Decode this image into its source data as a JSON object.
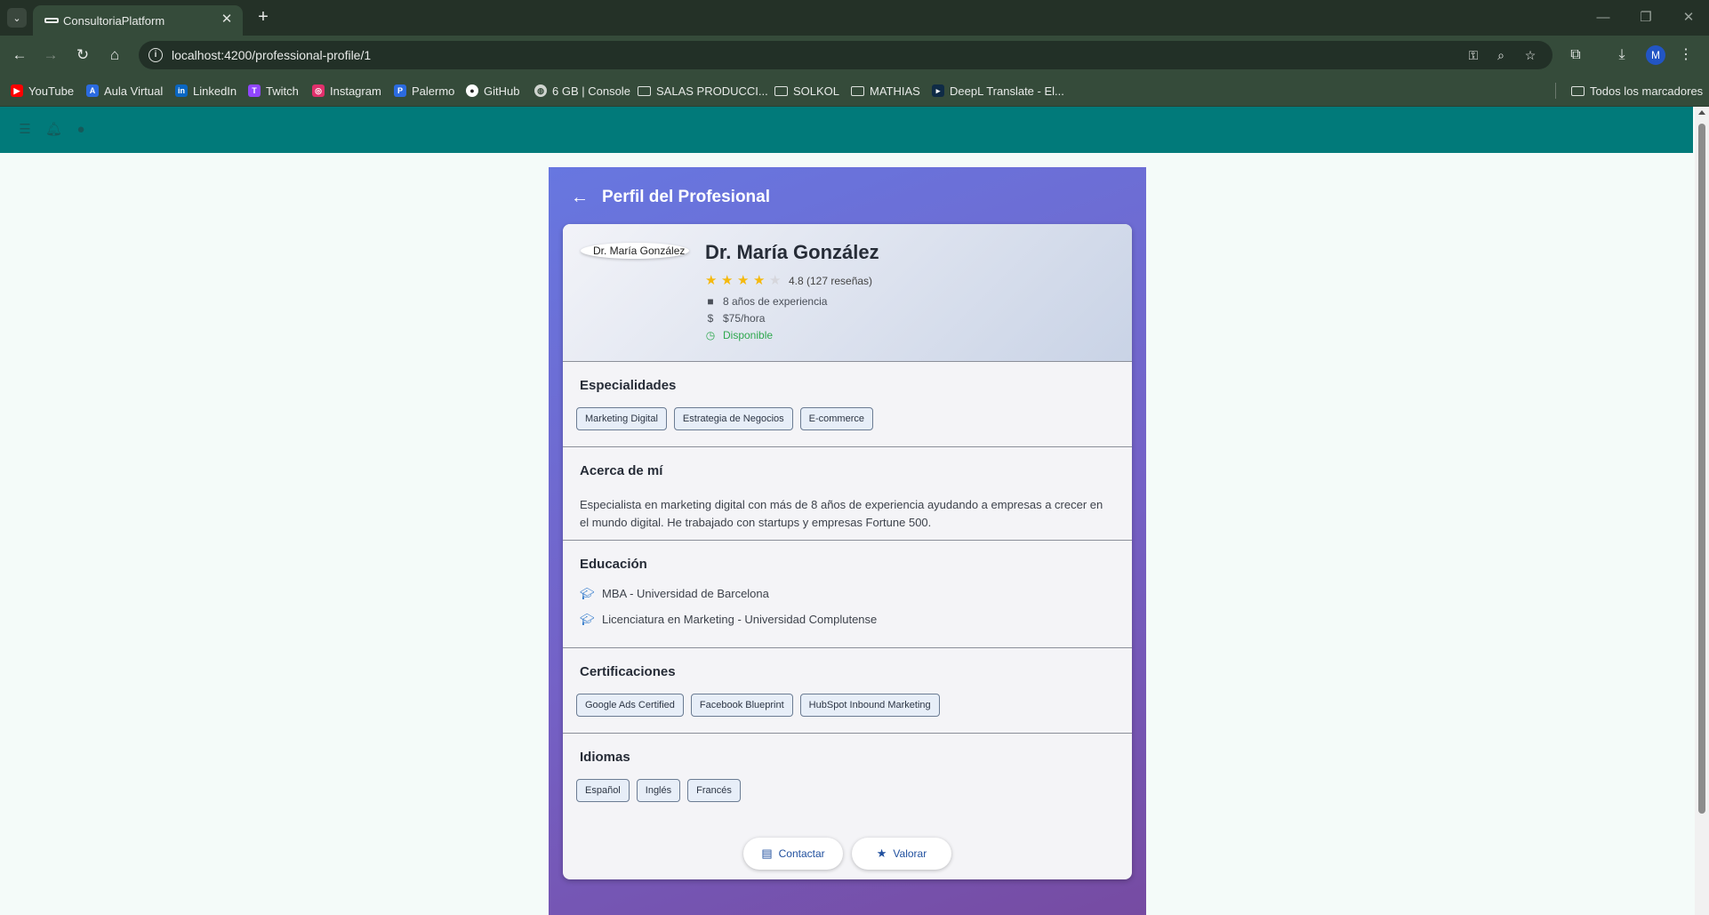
{
  "browser": {
    "tab_title": "ConsultoriaPlatform",
    "url": "localhost:4200/professional-profile/1",
    "profile_initial": "M",
    "bookmarks": [
      {
        "label": "YouTube",
        "icon": "youtube-icon",
        "color": "#ff0000"
      },
      {
        "label": "Aula Virtual",
        "icon": "aula-virtual-icon",
        "color": "#2b6be0"
      },
      {
        "label": "LinkedIn",
        "icon": "linkedin-icon",
        "color": "#0a66c2"
      },
      {
        "label": "Twitch",
        "icon": "twitch-icon",
        "color": "#9146ff"
      },
      {
        "label": "Instagram",
        "icon": "instagram-icon",
        "color": "#e1306c"
      },
      {
        "label": "Palermo",
        "icon": "palermo-icon",
        "color": "#2b6be0"
      },
      {
        "label": "GitHub",
        "icon": "github-icon",
        "color": "#ffffff"
      },
      {
        "label": "6 GB | Console",
        "icon": "globe-icon",
        "color": "#cfd4cf"
      },
      {
        "label": "SALAS PRODUCCI...",
        "icon": "folder-icon"
      },
      {
        "label": "SOLKOL",
        "icon": "folder-icon"
      },
      {
        "label": "MATHIAS",
        "icon": "folder-icon"
      },
      {
        "label": "DeepL Translate - El...",
        "icon": "deepl-icon",
        "color": "#0f2b46"
      }
    ],
    "all_bookmarks": "Todos los marcadores"
  },
  "page": {
    "title": "Perfil del Profesional",
    "professional": {
      "photo_alt": "Dr. María González",
      "name": "Dr. María González",
      "rating": 4.8,
      "rating_text": "4.8 (127 reseñas)",
      "experience": "8 años de experiencia",
      "rate": "$75/hora",
      "availability": "Disponible"
    },
    "specialties": {
      "title": "Especialidades",
      "items": [
        "Marketing Digital",
        "Estrategia de Negocios",
        "E-commerce"
      ]
    },
    "about": {
      "title": "Acerca de mí",
      "text": "Especialista en marketing digital con más de 8 años de experiencia ayudando a empresas a crecer en el mundo digital. He trabajado con startups y empresas Fortune 500."
    },
    "education": {
      "title": "Educación",
      "items": [
        "MBA - Universidad de Barcelona",
        "Licenciatura en Marketing - Universidad Complutense"
      ]
    },
    "certifications": {
      "title": "Certificaciones",
      "items": [
        "Google Ads Certified",
        "Facebook Blueprint",
        "HubSpot Inbound Marketing"
      ]
    },
    "languages": {
      "title": "Idiomas",
      "items": [
        "Español",
        "Inglés",
        "Francés"
      ]
    },
    "actions": {
      "contact": "Contactar",
      "rate": "Valorar"
    }
  },
  "colors": {
    "header": "#017a7a",
    "gradient_start": "#667eea",
    "gradient_end": "#764ba2",
    "star": "#f5b90e",
    "available": "#2fa84f",
    "action_text": "#1f4f9e"
  }
}
